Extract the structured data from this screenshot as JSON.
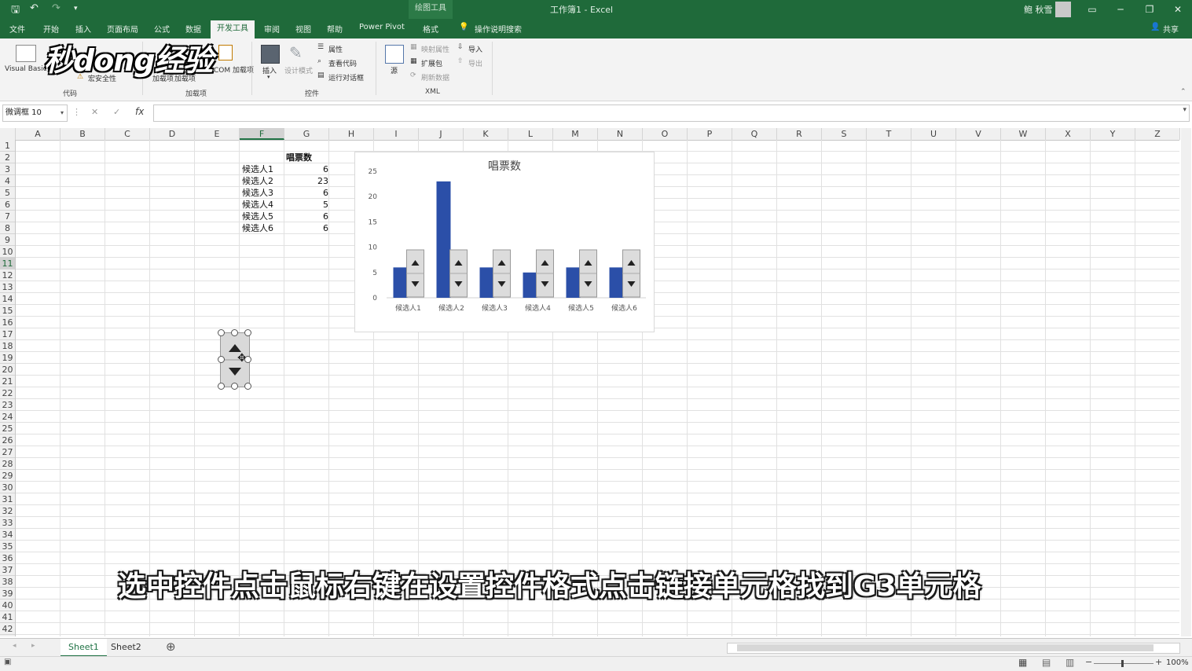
{
  "titlebar": {
    "context_tools": "绘图工具",
    "document_title": "工作簿1  -  Excel",
    "user_name": "鲍 秋雪"
  },
  "tabs": [
    "文件",
    "开始",
    "插入",
    "页面布局",
    "公式",
    "数据",
    "开发工具",
    "审阅",
    "视图",
    "帮助",
    "Power Pivot",
    "格式"
  ],
  "active_tab": "开发工具",
  "search_label": "操作说明搜索",
  "share_label": "共享",
  "ribbon": {
    "code": {
      "visual_basic": "Visual Basic",
      "macro_security": "宏安全性",
      "group": "代码"
    },
    "addins": {
      "addins": "加载项",
      "excel_addins": "加载项",
      "com_addins": "COM 加载项",
      "group": "加载项"
    },
    "controls": {
      "insert": "插入",
      "design_mode": "设计模式",
      "properties": "属性",
      "view_code": "查看代码",
      "run_dialog": "运行对话框",
      "group": "控件"
    },
    "xml": {
      "source": "源",
      "map_properties": "映射属性",
      "expansion_packs": "扩展包",
      "refresh_data": "刷新数据",
      "import": "导入",
      "export": "导出",
      "group": "XML"
    }
  },
  "watermark": "秒dong经验",
  "namebox": "微调框 10",
  "columns": [
    "A",
    "B",
    "C",
    "D",
    "E",
    "F",
    "G",
    "H",
    "I",
    "J",
    "K",
    "L",
    "M",
    "N",
    "O",
    "P",
    "Q",
    "R",
    "S",
    "T",
    "U",
    "V",
    "W",
    "X",
    "Y",
    "Z"
  ],
  "selected_column": "F",
  "rows": [
    "1",
    "2",
    "3",
    "4",
    "5",
    "6",
    "7",
    "8",
    "9",
    "10",
    "11",
    "12",
    "13",
    "14",
    "15",
    "16",
    "17",
    "18",
    "19",
    "20",
    "21",
    "22",
    "23",
    "24",
    "25",
    "26",
    "27",
    "28",
    "29",
    "30",
    "31",
    "32",
    "33",
    "34",
    "35",
    "36",
    "37",
    "38",
    "39",
    "40",
    "41",
    "42"
  ],
  "selected_row": "11",
  "table": {
    "header": "唱票数",
    "rows": [
      {
        "name": "候选人1",
        "votes": "6"
      },
      {
        "name": "候选人2",
        "votes": "23"
      },
      {
        "name": "候选人3",
        "votes": "6"
      },
      {
        "name": "候选人4",
        "votes": "5"
      },
      {
        "name": "候选人5",
        "votes": "6"
      },
      {
        "name": "候选人6",
        "votes": "6"
      }
    ]
  },
  "chart_data": {
    "type": "bar",
    "title": "唱票数",
    "categories": [
      "候选人1",
      "候选人2",
      "候选人3",
      "候选人4",
      "候选人5",
      "候选人6"
    ],
    "values": [
      6,
      23,
      6,
      5,
      6,
      6
    ],
    "ylim": [
      0,
      25
    ],
    "yticks": [
      "0",
      "5",
      "10",
      "15",
      "20",
      "25"
    ],
    "bar_color": "#2b4fa8",
    "grid": false,
    "legend": "none"
  },
  "subtitle": "选中控件点击鼠标右键在设置控件格式点击链接单元格找到G3单元格",
  "sheets": [
    "Sheet1",
    "Sheet2"
  ],
  "active_sheet": "Sheet1",
  "zoom": "100%",
  "colors": {
    "excel_green": "#217346",
    "titlebar": "#1f6a3a"
  }
}
